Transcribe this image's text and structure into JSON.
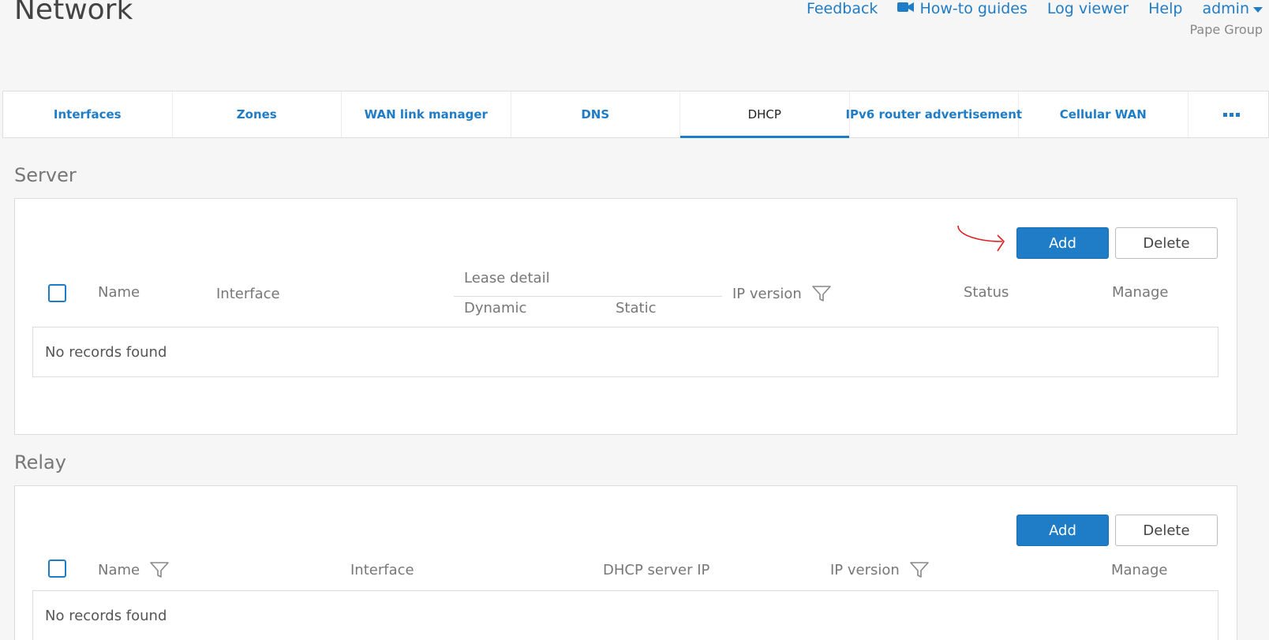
{
  "header": {
    "title": "Network",
    "links": {
      "feedback": "Feedback",
      "howto": "How-to guides",
      "logviewer": "Log viewer",
      "help": "Help",
      "admin": "admin"
    },
    "organization": "Pape Group"
  },
  "tabs": [
    {
      "label": "Interfaces"
    },
    {
      "label": "Zones"
    },
    {
      "label": "WAN link manager"
    },
    {
      "label": "DNS"
    },
    {
      "label": "DHCP",
      "active": true
    },
    {
      "label": "IPv6 router advertisement"
    },
    {
      "label": "Cellular WAN"
    }
  ],
  "server": {
    "title": "Server",
    "add_label": "Add",
    "delete_label": "Delete",
    "columns": {
      "name": "Name",
      "interface": "Interface",
      "lease_detail": "Lease detail",
      "dynamic": "Dynamic",
      "static": "Static",
      "ip_version": "IP version",
      "status": "Status",
      "manage": "Manage"
    },
    "empty": "No records found"
  },
  "relay": {
    "title": "Relay",
    "add_label": "Add",
    "delete_label": "Delete",
    "columns": {
      "name": "Name",
      "interface": "Interface",
      "dhcp_server_ip": "DHCP server IP",
      "ip_version": "IP version",
      "manage": "Manage"
    },
    "empty": "No records found"
  },
  "colors": {
    "accent": "#1f7cc6",
    "annotation": "#e02020"
  }
}
